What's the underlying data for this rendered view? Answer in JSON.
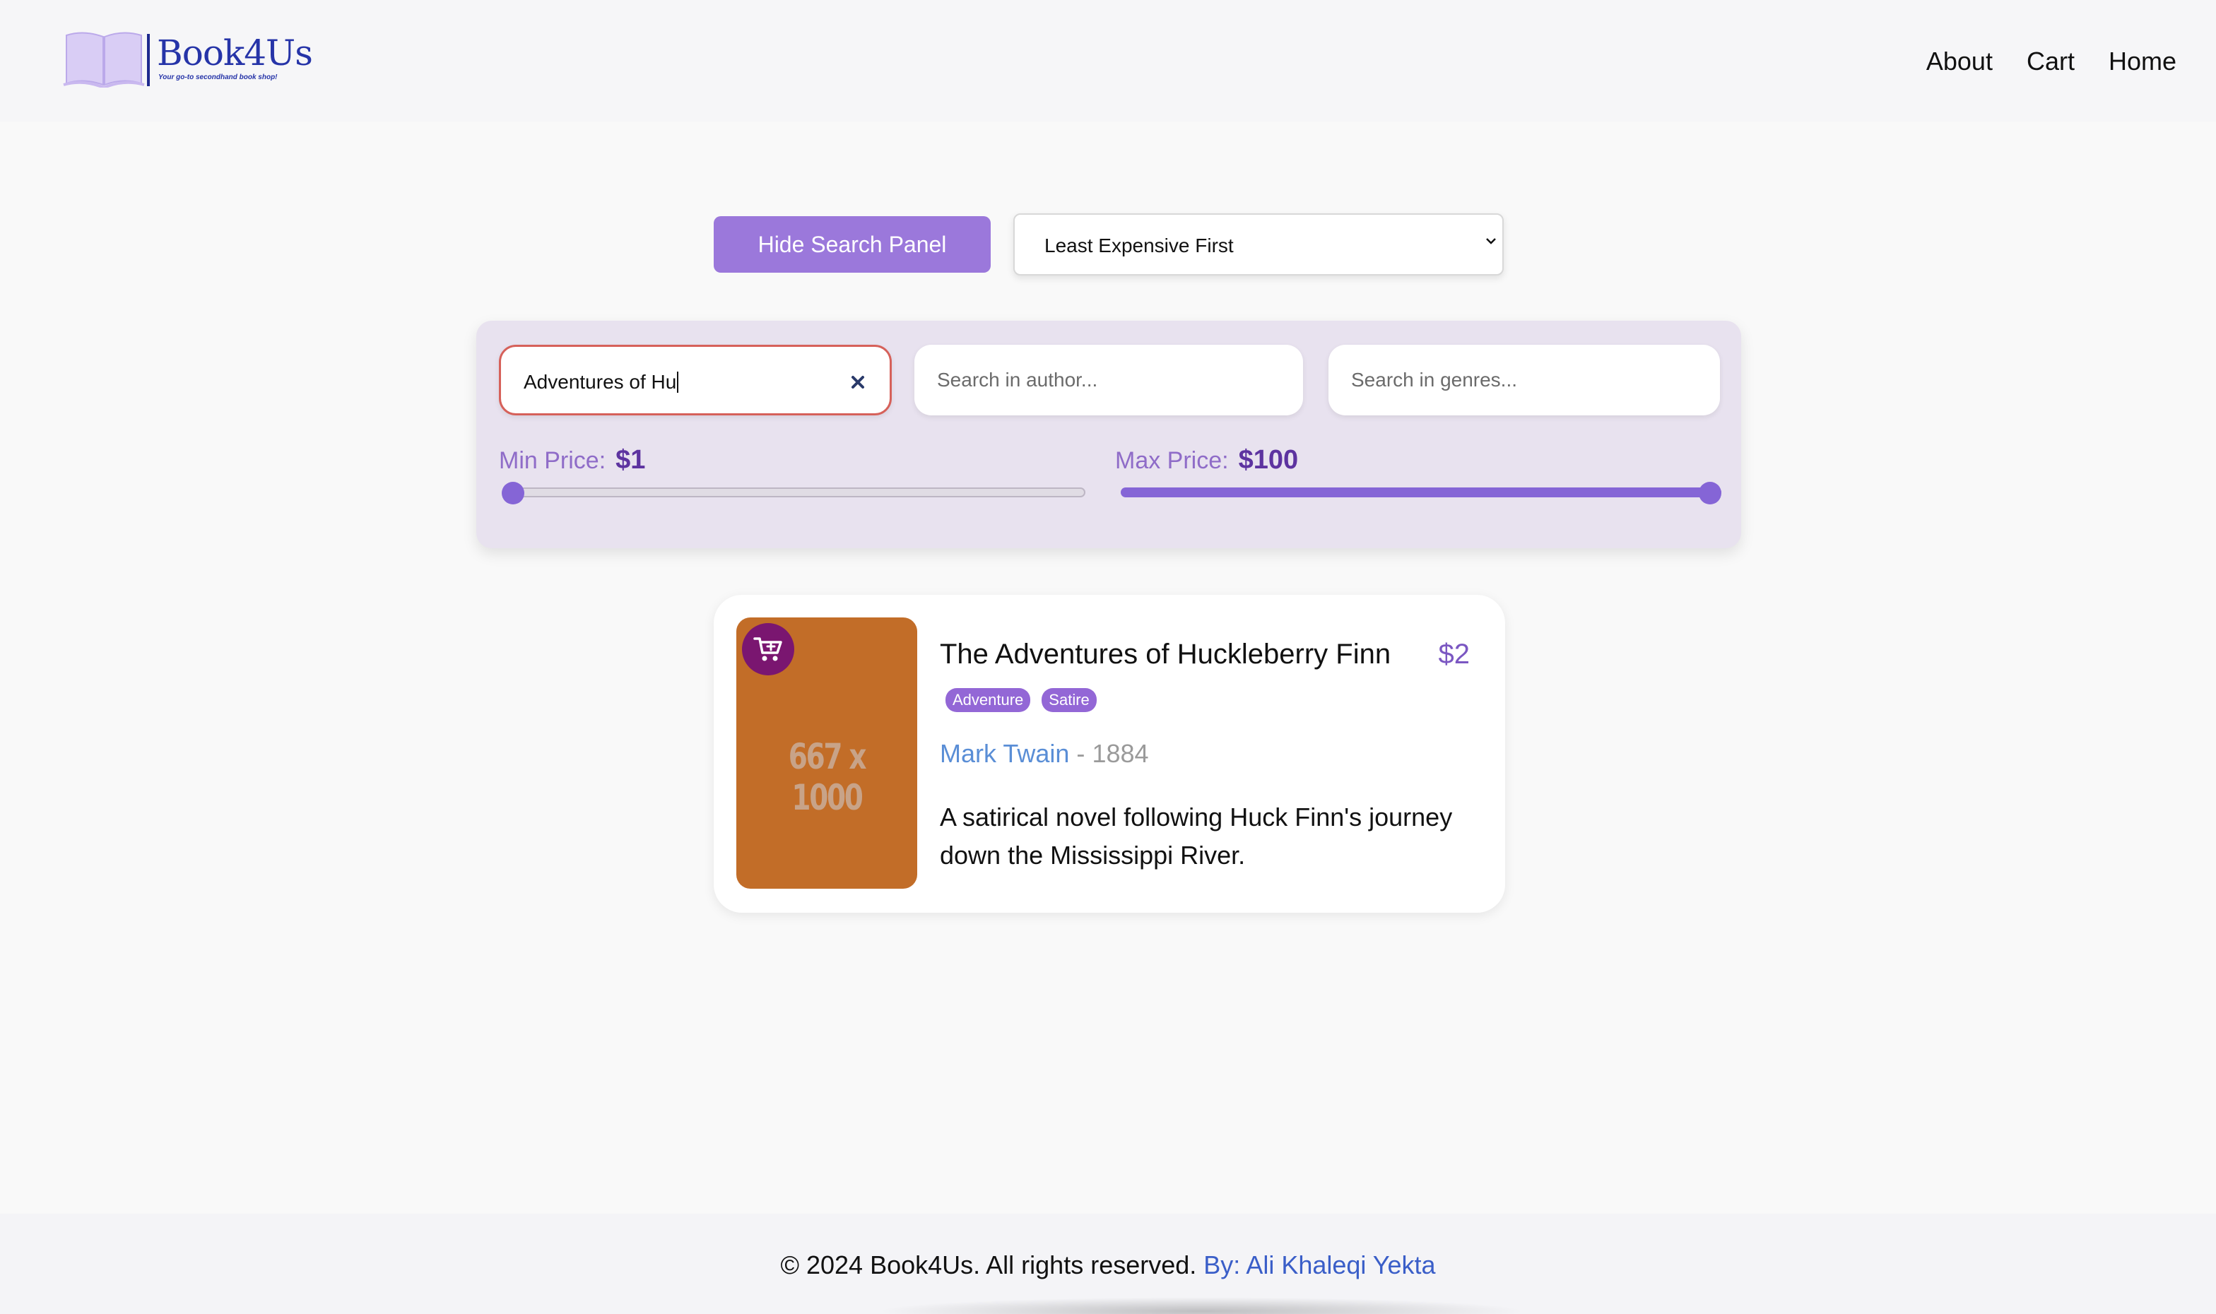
{
  "header": {
    "brand": "Book4Us",
    "tagline": "Your go-to secondhand book shop!",
    "nav": [
      "About",
      "Cart",
      "Home"
    ]
  },
  "controls": {
    "toggle_label": "Hide Search Panel",
    "sort_selected": "Least Expensive First"
  },
  "search": {
    "title_value": "Adventures of Hu",
    "author_placeholder": "Search in author...",
    "genres_placeholder": "Search in genres...",
    "min_price_label": "Min Price:",
    "min_price_value": "$1",
    "max_price_label": "Max Price:",
    "max_price_value": "$100",
    "min_price_fraction": 0.0,
    "max_price_fraction": 1.0
  },
  "results": [
    {
      "title": "The Adventures of Huckleberry Finn",
      "price": "$2",
      "genres": [
        "Adventure",
        "Satire"
      ],
      "author": "Mark Twain",
      "year_sep": "-",
      "year": "1884",
      "description": "A satirical novel following Huck Finn's journey down the Mississippi River.",
      "cover_placeholder": "667 x 1000"
    }
  ],
  "footer": {
    "copyright": "© 2024 Book4Us. All rights reserved.",
    "credit": "By: Ali Khaleqi Yekta"
  },
  "colors": {
    "accent": "#9b78db",
    "panel": "#e8e2ef",
    "cart_button": "#7a1670",
    "cover": "#c26d28",
    "author_link": "#5a8ed6"
  },
  "icons": [
    "book-logo-icon",
    "close-icon",
    "chevron-down-icon",
    "add-to-cart-icon"
  ]
}
